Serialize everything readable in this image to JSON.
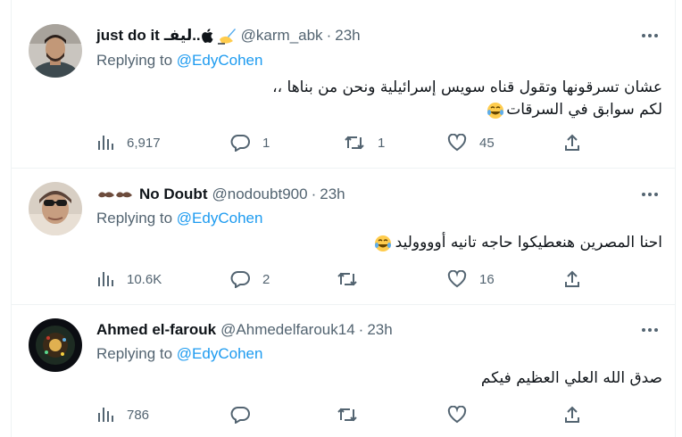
{
  "tweets": [
    {
      "name": "just do it",
      "name_extra": "ليفـ.. ",
      "handle": "@karm_abk",
      "time": "23h",
      "replying_prefix": "Replying to",
      "replying_to": "@EdyCohen",
      "text_line1": "عشان تسرقونها وتقول قناه سويس إسرائيلية ونحن من بناها ،،",
      "text_line2": "لكم سوابق في السرقات",
      "views": "6,917",
      "replies": "1",
      "retweets": "1",
      "likes": "45"
    },
    {
      "name": "No Doubt",
      "handle": "@nodoubt900",
      "time": "23h",
      "replying_prefix": "Replying to",
      "replying_to": "@EdyCohen",
      "text_line1": "احنا المصرين هنعطيكوا حاجه تانيه أووووليد",
      "views": "10.6K",
      "replies": "2",
      "retweets": "",
      "likes": "16"
    },
    {
      "name": "Ahmed el-farouk",
      "handle": "@Ahmedelfarouk14",
      "time": "23h",
      "replying_prefix": "Replying to",
      "replying_to": "@EdyCohen",
      "text_line1": "صدق الله العلي العظيم فيكم",
      "views": "786",
      "replies": "",
      "retweets": "",
      "likes": ""
    }
  ],
  "dot_separator": "·",
  "colors": {
    "accent": "#1d9bf0",
    "secondary": "#536471",
    "text": "#0f1419",
    "border": "#eff3f4"
  }
}
